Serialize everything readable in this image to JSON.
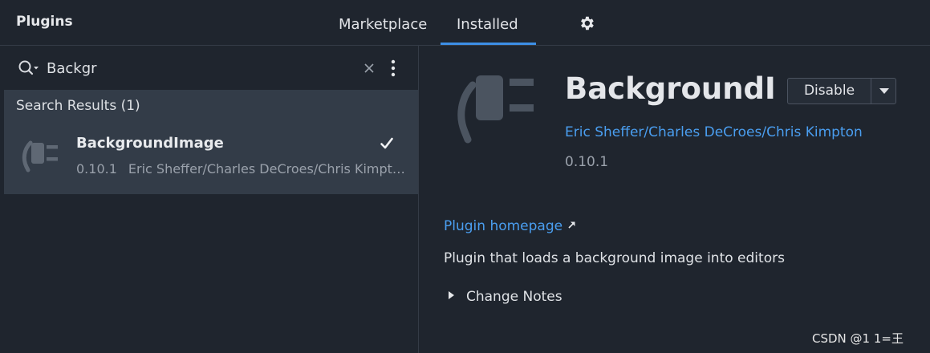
{
  "header": {
    "title": "Plugins",
    "tabs": [
      {
        "label": "Marketplace",
        "active": false
      },
      {
        "label": "Installed",
        "active": true
      }
    ],
    "settings_icon": "gear-icon"
  },
  "search": {
    "value": "Backgr",
    "icon": "search-icon",
    "clear_icon": "close-icon",
    "more_icon": "kebab-menu-icon"
  },
  "results": {
    "header": "Search Results (1)",
    "items": [
      {
        "name": "BackgroundImage",
        "version": "0.10.1",
        "authors": "Eric Sheffer/Charles DeCroes/Chris Kimpton",
        "enabled": true,
        "icon": "plugin-plug-icon"
      }
    ]
  },
  "detail": {
    "name": "BackgroundImage",
    "disable_label": "Disable",
    "authors": "Eric Sheffer/Charles DeCroes/Chris Kimpton",
    "version": "0.10.1",
    "homepage_label": "Plugin homepage",
    "description": "Plugin that loads a background image into editors",
    "change_notes_label": "Change Notes"
  },
  "colors": {
    "background": "#1f252e",
    "selected_row": "#333c48",
    "accent": "#3d8fe6",
    "link": "#4a9ef0"
  },
  "watermark": "CSDN @1 1=王"
}
